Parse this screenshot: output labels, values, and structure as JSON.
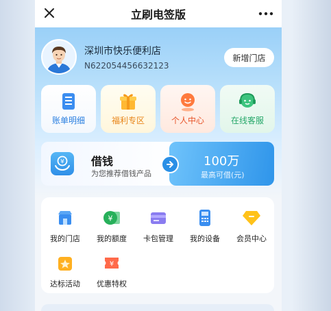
{
  "nav": {
    "title": "立刷电签版"
  },
  "profile": {
    "store_name": "深圳市快乐便利店",
    "store_id": "N622054456632123",
    "add_store_label": "新增门店"
  },
  "quick_tiles": [
    {
      "label": "账单明细",
      "icon": "bill-icon",
      "color": "#2a7fe0"
    },
    {
      "label": "福利专区",
      "icon": "gift-icon",
      "color": "#e8861a"
    },
    {
      "label": "个人中心",
      "icon": "person-icon",
      "color": "#e8552a"
    },
    {
      "label": "在线客服",
      "icon": "customer-service-icon",
      "color": "#27a86a"
    }
  ],
  "loan": {
    "title": "借钱",
    "subtitle": "为您推荐借钱产品",
    "amount": "100万",
    "amount_label": "最高可借(元)"
  },
  "services": [
    {
      "label": "我的门店",
      "icon": "store-icon"
    },
    {
      "label": "我的额度",
      "icon": "quota-icon"
    },
    {
      "label": "卡包管理",
      "icon": "card-wallet-icon"
    },
    {
      "label": "我的设备",
      "icon": "device-icon"
    },
    {
      "label": "会员中心",
      "icon": "member-icon"
    },
    {
      "label": "达标活动",
      "icon": "activity-icon"
    },
    {
      "label": "优惠特权",
      "icon": "coupon-icon"
    }
  ]
}
